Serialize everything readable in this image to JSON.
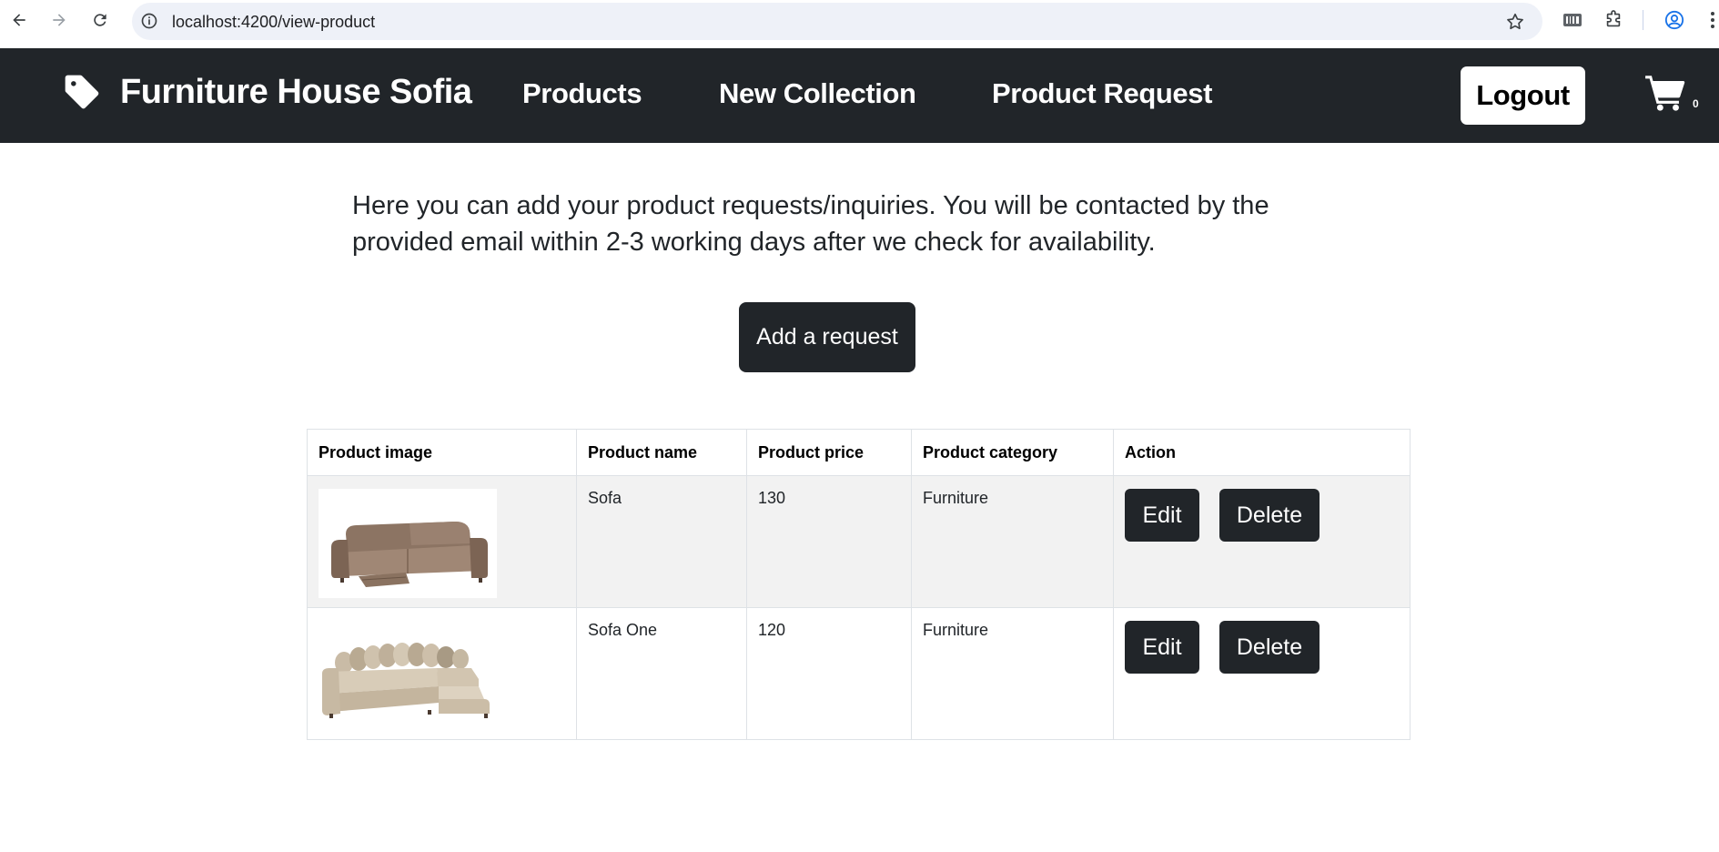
{
  "browser": {
    "url": "localhost:4200/view-product"
  },
  "navbar": {
    "brand": "Furniture House Sofia",
    "links": [
      "Products",
      "New Collection",
      "Product Request"
    ],
    "logout_label": "Logout",
    "cart_count": "0"
  },
  "main": {
    "intro_text": "Here you can add your product requests/inquiries. You will be contacted by the provided email within 2-3 working days after we check for availability.",
    "add_request_label": "Add a request"
  },
  "table": {
    "headers": [
      "Product image",
      "Product name",
      "Product price",
      "Product category",
      "Action"
    ],
    "rows": [
      {
        "image": "sofa-recliner-image",
        "name": "Sofa",
        "price": "130",
        "category": "Furniture",
        "edit_label": "Edit",
        "delete_label": "Delete"
      },
      {
        "image": "corner-sofa-image",
        "name": "Sofa One",
        "price": "120",
        "category": "Furniture",
        "edit_label": "Edit",
        "delete_label": "Delete"
      }
    ]
  }
}
